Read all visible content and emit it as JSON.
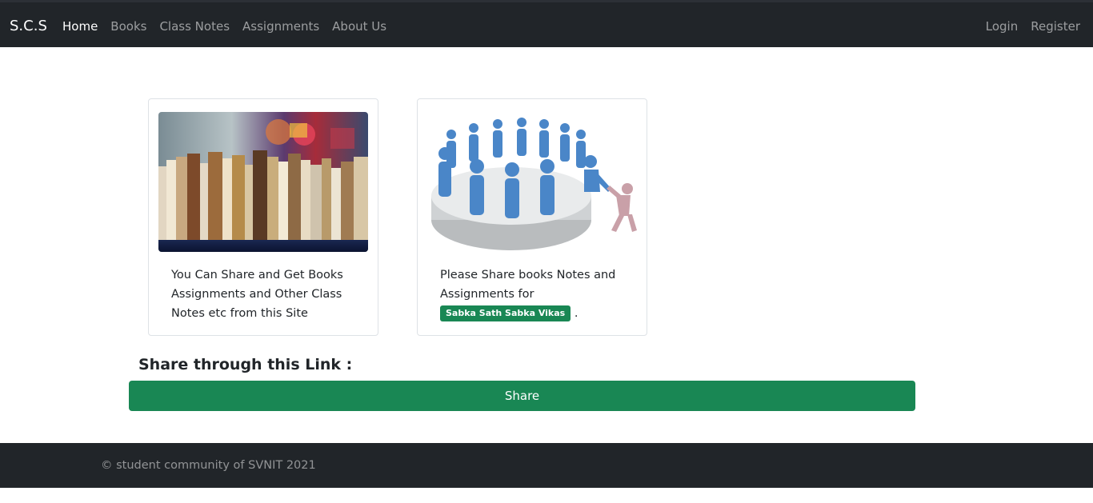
{
  "navbar": {
    "brand": "S.C.S",
    "left_links": [
      {
        "label": "Home",
        "active": true
      },
      {
        "label": "Books"
      },
      {
        "label": "Class Notes"
      },
      {
        "label": "Assignments"
      },
      {
        "label": "About Us"
      }
    ],
    "right_links": [
      {
        "label": "Login"
      },
      {
        "label": "Register"
      }
    ]
  },
  "cards": [
    {
      "image": "books-on-shelf-photo",
      "text": "You Can Share and Get Books Assignments and Other Class Notes etc from this Site"
    },
    {
      "image": "community-circle-people-illustration",
      "text": "Please Share books Notes and Assignments for",
      "badge": "Sabka Sath Sabka Vikas",
      "suffix": "."
    }
  ],
  "share": {
    "heading": "Share through this Link :",
    "button_label": "Share"
  },
  "footer": {
    "text": "© student community of SVNIT 2021"
  },
  "colors": {
    "navbar_bg": "#212529",
    "accent_green": "#198754"
  }
}
